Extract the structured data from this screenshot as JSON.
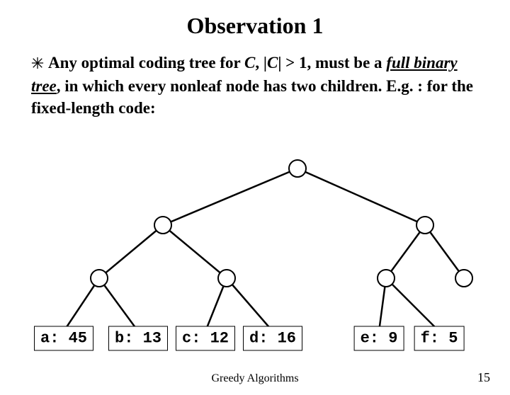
{
  "title": "Observation 1",
  "body_parts": {
    "pre": "Any optimal coding tree for ",
    "C": "C",
    "mid1": ", |",
    "C2": "C",
    "mid2": "| > 1, must be a ",
    "full_bt": "full binary tree",
    "rest": ", in which every nonleaf node has two children. E.g. : for the fixed-length code:"
  },
  "leaves": [
    {
      "label": "a: 45"
    },
    {
      "label": "b: 13"
    },
    {
      "label": "c: 12"
    },
    {
      "label": "d: 16"
    },
    {
      "label": "e: 9"
    },
    {
      "label": "f: 5"
    }
  ],
  "footer": {
    "center": "Greedy Algorithms",
    "page": "15"
  },
  "chart_data": {
    "type": "tree",
    "description": "Full binary coding tree for fixed-length code",
    "internal_nodes": [
      "root",
      "L",
      "LL",
      "LR",
      "R",
      "RL",
      "RR"
    ],
    "edges": [
      [
        "root",
        "L"
      ],
      [
        "root",
        "R"
      ],
      [
        "L",
        "LL"
      ],
      [
        "L",
        "LR"
      ],
      [
        "R",
        "RL"
      ],
      [
        "R",
        "RR"
      ],
      [
        "LL",
        "a"
      ],
      [
        "LL",
        "b"
      ],
      [
        "LR",
        "c"
      ],
      [
        "LR",
        "d"
      ],
      [
        "RL",
        "e"
      ],
      [
        "RL",
        "f"
      ]
    ],
    "leaves": {
      "a": 45,
      "b": 13,
      "c": 12,
      "d": 16,
      "e": 9,
      "f": 5
    }
  }
}
